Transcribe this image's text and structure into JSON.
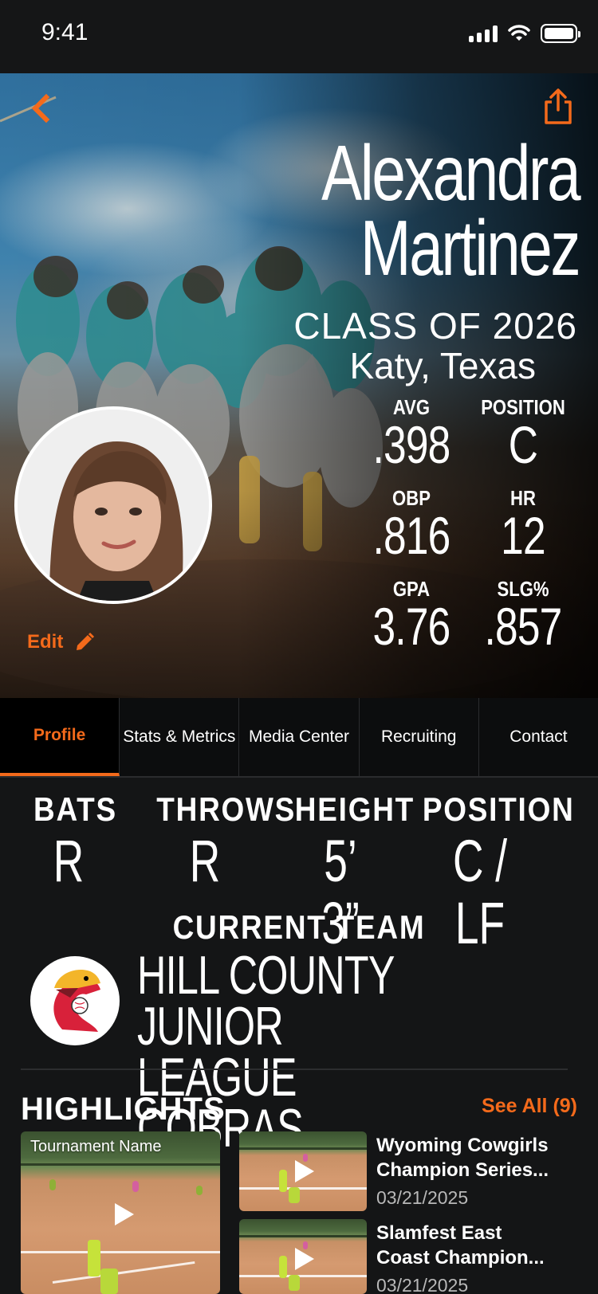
{
  "status_bar": {
    "time": "9:41"
  },
  "player": {
    "first_name": "Alexandra",
    "last_name": "Martinez",
    "class": "CLASS OF 2026",
    "location": "Katy, Texas",
    "edit_label": "Edit"
  },
  "hero_stats": [
    {
      "label": "AVG",
      "value": ".398"
    },
    {
      "label": "POSITION",
      "value": "C"
    },
    {
      "label": "OBP",
      "value": ".816"
    },
    {
      "label": "HR",
      "value": "12"
    },
    {
      "label": "GPA",
      "value": "3.76"
    },
    {
      "label": "SLG%",
      "value": ".857"
    }
  ],
  "tabs": [
    {
      "label": "Profile",
      "active": true
    },
    {
      "label": "Stats & Metrics",
      "active": false
    },
    {
      "label": "Media Center",
      "active": false
    },
    {
      "label": "Recruiting",
      "active": false
    },
    {
      "label": "Contact",
      "active": false
    }
  ],
  "attributes": [
    {
      "label": "BATS",
      "value": "R"
    },
    {
      "label": "THROWS",
      "value": "R"
    },
    {
      "label": "HEIGHT",
      "value": "5’ 3”"
    },
    {
      "label": "POSITION",
      "value": "C / LF"
    }
  ],
  "team": {
    "heading": "CURRENT TEAM",
    "name_line1": "HILL COUNTY JUNIOR",
    "name_line2": "LEAGUE COBRAS"
  },
  "highlights": {
    "title": "HIGHLIGHTS",
    "see_all": "See All (9)",
    "featured": {
      "label": "Tournament Name"
    },
    "videos": [
      {
        "title_line1": "Wyoming Cowgirls",
        "title_line2": "Champion Series...",
        "date": "03/21/2025"
      },
      {
        "title_line1": "Slamfest East",
        "title_line2": "Coast Champion...",
        "date": "03/21/2025"
      }
    ]
  },
  "colors": {
    "accent": "#f46a1b",
    "background": "#141516",
    "tab_bar": "#0c0d0e"
  },
  "icons": [
    "back-chevron-icon",
    "share-icon",
    "pencil-icon",
    "play-icon",
    "signal-icon",
    "wifi-icon",
    "battery-icon",
    "cobra-logo-icon"
  ]
}
